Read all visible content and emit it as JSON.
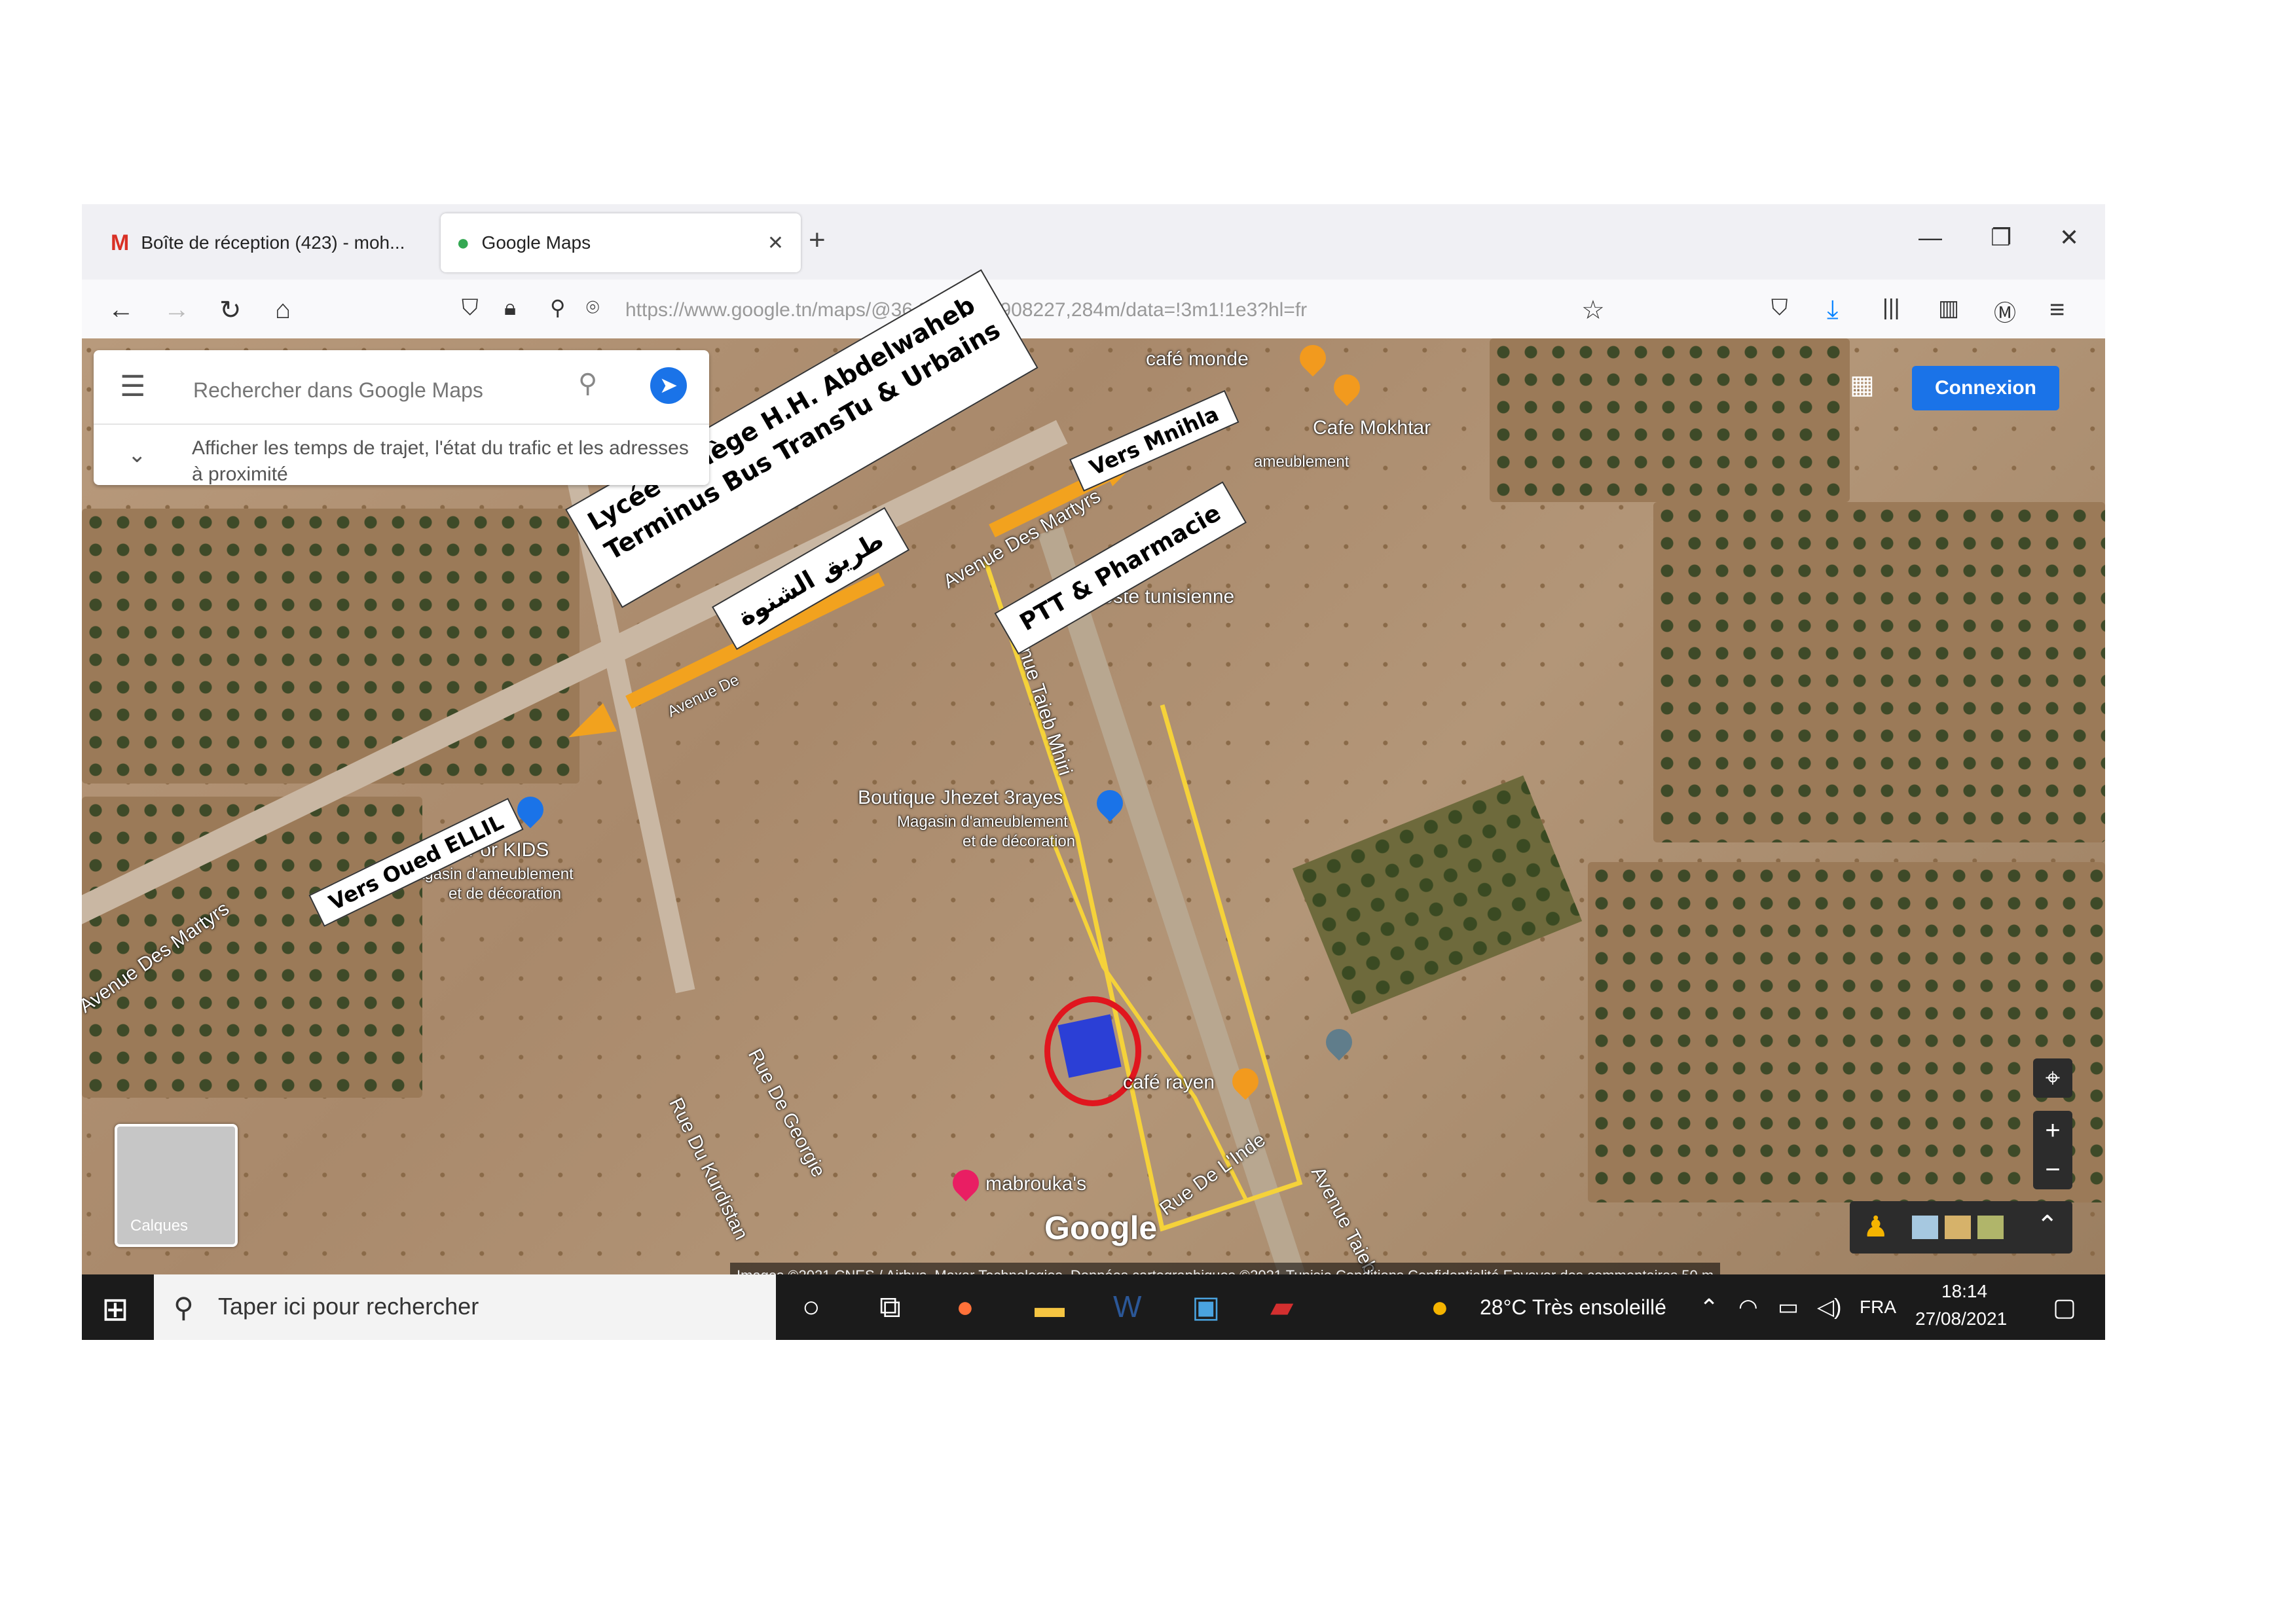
{
  "browser": {
    "tabs": [
      {
        "icon": "gmail-icon",
        "label": "Boîte de réception (423) - moh..."
      },
      {
        "icon": "google-maps-icon",
        "label": "Google Maps"
      }
    ],
    "url": "https://www.google.tn/maps/@36.8...3,10.0908227,284m/data=!3m1!1e3?hl=fr",
    "url_host": "google.tn"
  },
  "maps": {
    "search_placeholder": "Rechercher dans Google Maps",
    "hint": "Afficher les temps de trajet, l'état du trafic et les adresses à proximité",
    "connexion": "Connexion",
    "layers": "Calques",
    "google": "Google",
    "attribution": "Images ©2021 CNES / Airbus, Maxar Technologies, Données cartographiques ©2021   Tunisie   Conditions   Confidentialité   Envoyer des commentaires   50 m",
    "places": {
      "cafe_monde": "café monde",
      "cafe_mokhtar": "Cafe Mokhtar",
      "ameublement": "ameublement",
      "poste": "La poste tunisienne",
      "boutique": "Boutique Jhezet 3rayes",
      "boutique_sub1": "Magasin d'ameublement",
      "boutique_sub2": "et de décoration",
      "for_kids": "For KIDS",
      "kids_sub1": "Magasin d'ameublement",
      "kids_sub2": "et de décoration",
      "cafe_rayen": "café rayen",
      "mabrouka": "mabrouka's"
    },
    "streets": {
      "martyrs_left": "Avenue Des Martyrs",
      "martyrs_top": "Avenue Des Martyrs",
      "taieb": "Avenue Taieb Mhiri",
      "taieb_bottom": "Avenue Taieb",
      "georgie": "Rue De Georgie",
      "kurdistan": "Rue Du Kurdistan",
      "linde": "Rue De L'Inde",
      "avenue_de": "Avenue De"
    }
  },
  "annotations": {
    "lycee": "Lycée  Collège H.H. Abdelwaheb",
    "terminus": "Terminus Bus TransTu & Urbains",
    "mnihla": "Vers Mnihla",
    "ptt": "PTT & Pharmacie",
    "chnoua": "طريق الشنوة",
    "oued_ellil": "Vers Oued ELLIL"
  },
  "taskbar": {
    "search": "Taper ici pour rechercher",
    "weather": "28°C  Très ensoleillé",
    "lang": "FRA",
    "time": "18:14",
    "date": "27/08/2021"
  },
  "colors": {
    "accent": "#1a73e8",
    "arrow": "#f2a21e",
    "marker": "#2b3fd6",
    "circle": "#e0161e",
    "route": "#f5d23a"
  }
}
